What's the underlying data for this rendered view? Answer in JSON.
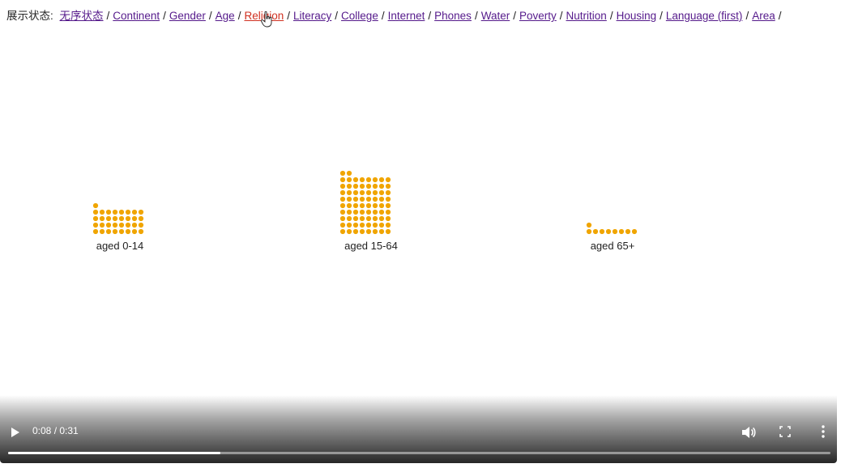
{
  "nav": {
    "label": "展示状态:",
    "links": [
      {
        "text": "无序状态",
        "active": false
      },
      {
        "text": "Continent",
        "active": false
      },
      {
        "text": "Gender",
        "active": false
      },
      {
        "text": "Age",
        "active": false
      },
      {
        "text": "Religion",
        "active": true
      },
      {
        "text": "Literacy",
        "active": false
      },
      {
        "text": "College",
        "active": false
      },
      {
        "text": "Internet",
        "active": false
      },
      {
        "text": "Phones",
        "active": false
      },
      {
        "text": "Water",
        "active": false
      },
      {
        "text": "Poverty",
        "active": false
      },
      {
        "text": "Nutrition",
        "active": false
      },
      {
        "text": "Housing",
        "active": false
      },
      {
        "text": "Language (first)",
        "active": false
      },
      {
        "text": "Area",
        "active": false
      }
    ],
    "separator": "/"
  },
  "chart_data": {
    "type": "dot-grid",
    "dot_color": "#f0a500",
    "columns": 8,
    "groups": [
      {
        "label": "aged 0-14",
        "count": 33
      },
      {
        "label": "aged 15-64",
        "count": 74
      },
      {
        "label": "aged 65+",
        "count": 9
      }
    ]
  },
  "video": {
    "time": "0:08 / 0:31",
    "progress": 0.258
  },
  "colors": {
    "accent": "#f0a500",
    "link": "#551a8b",
    "link_active": "#d03020"
  }
}
